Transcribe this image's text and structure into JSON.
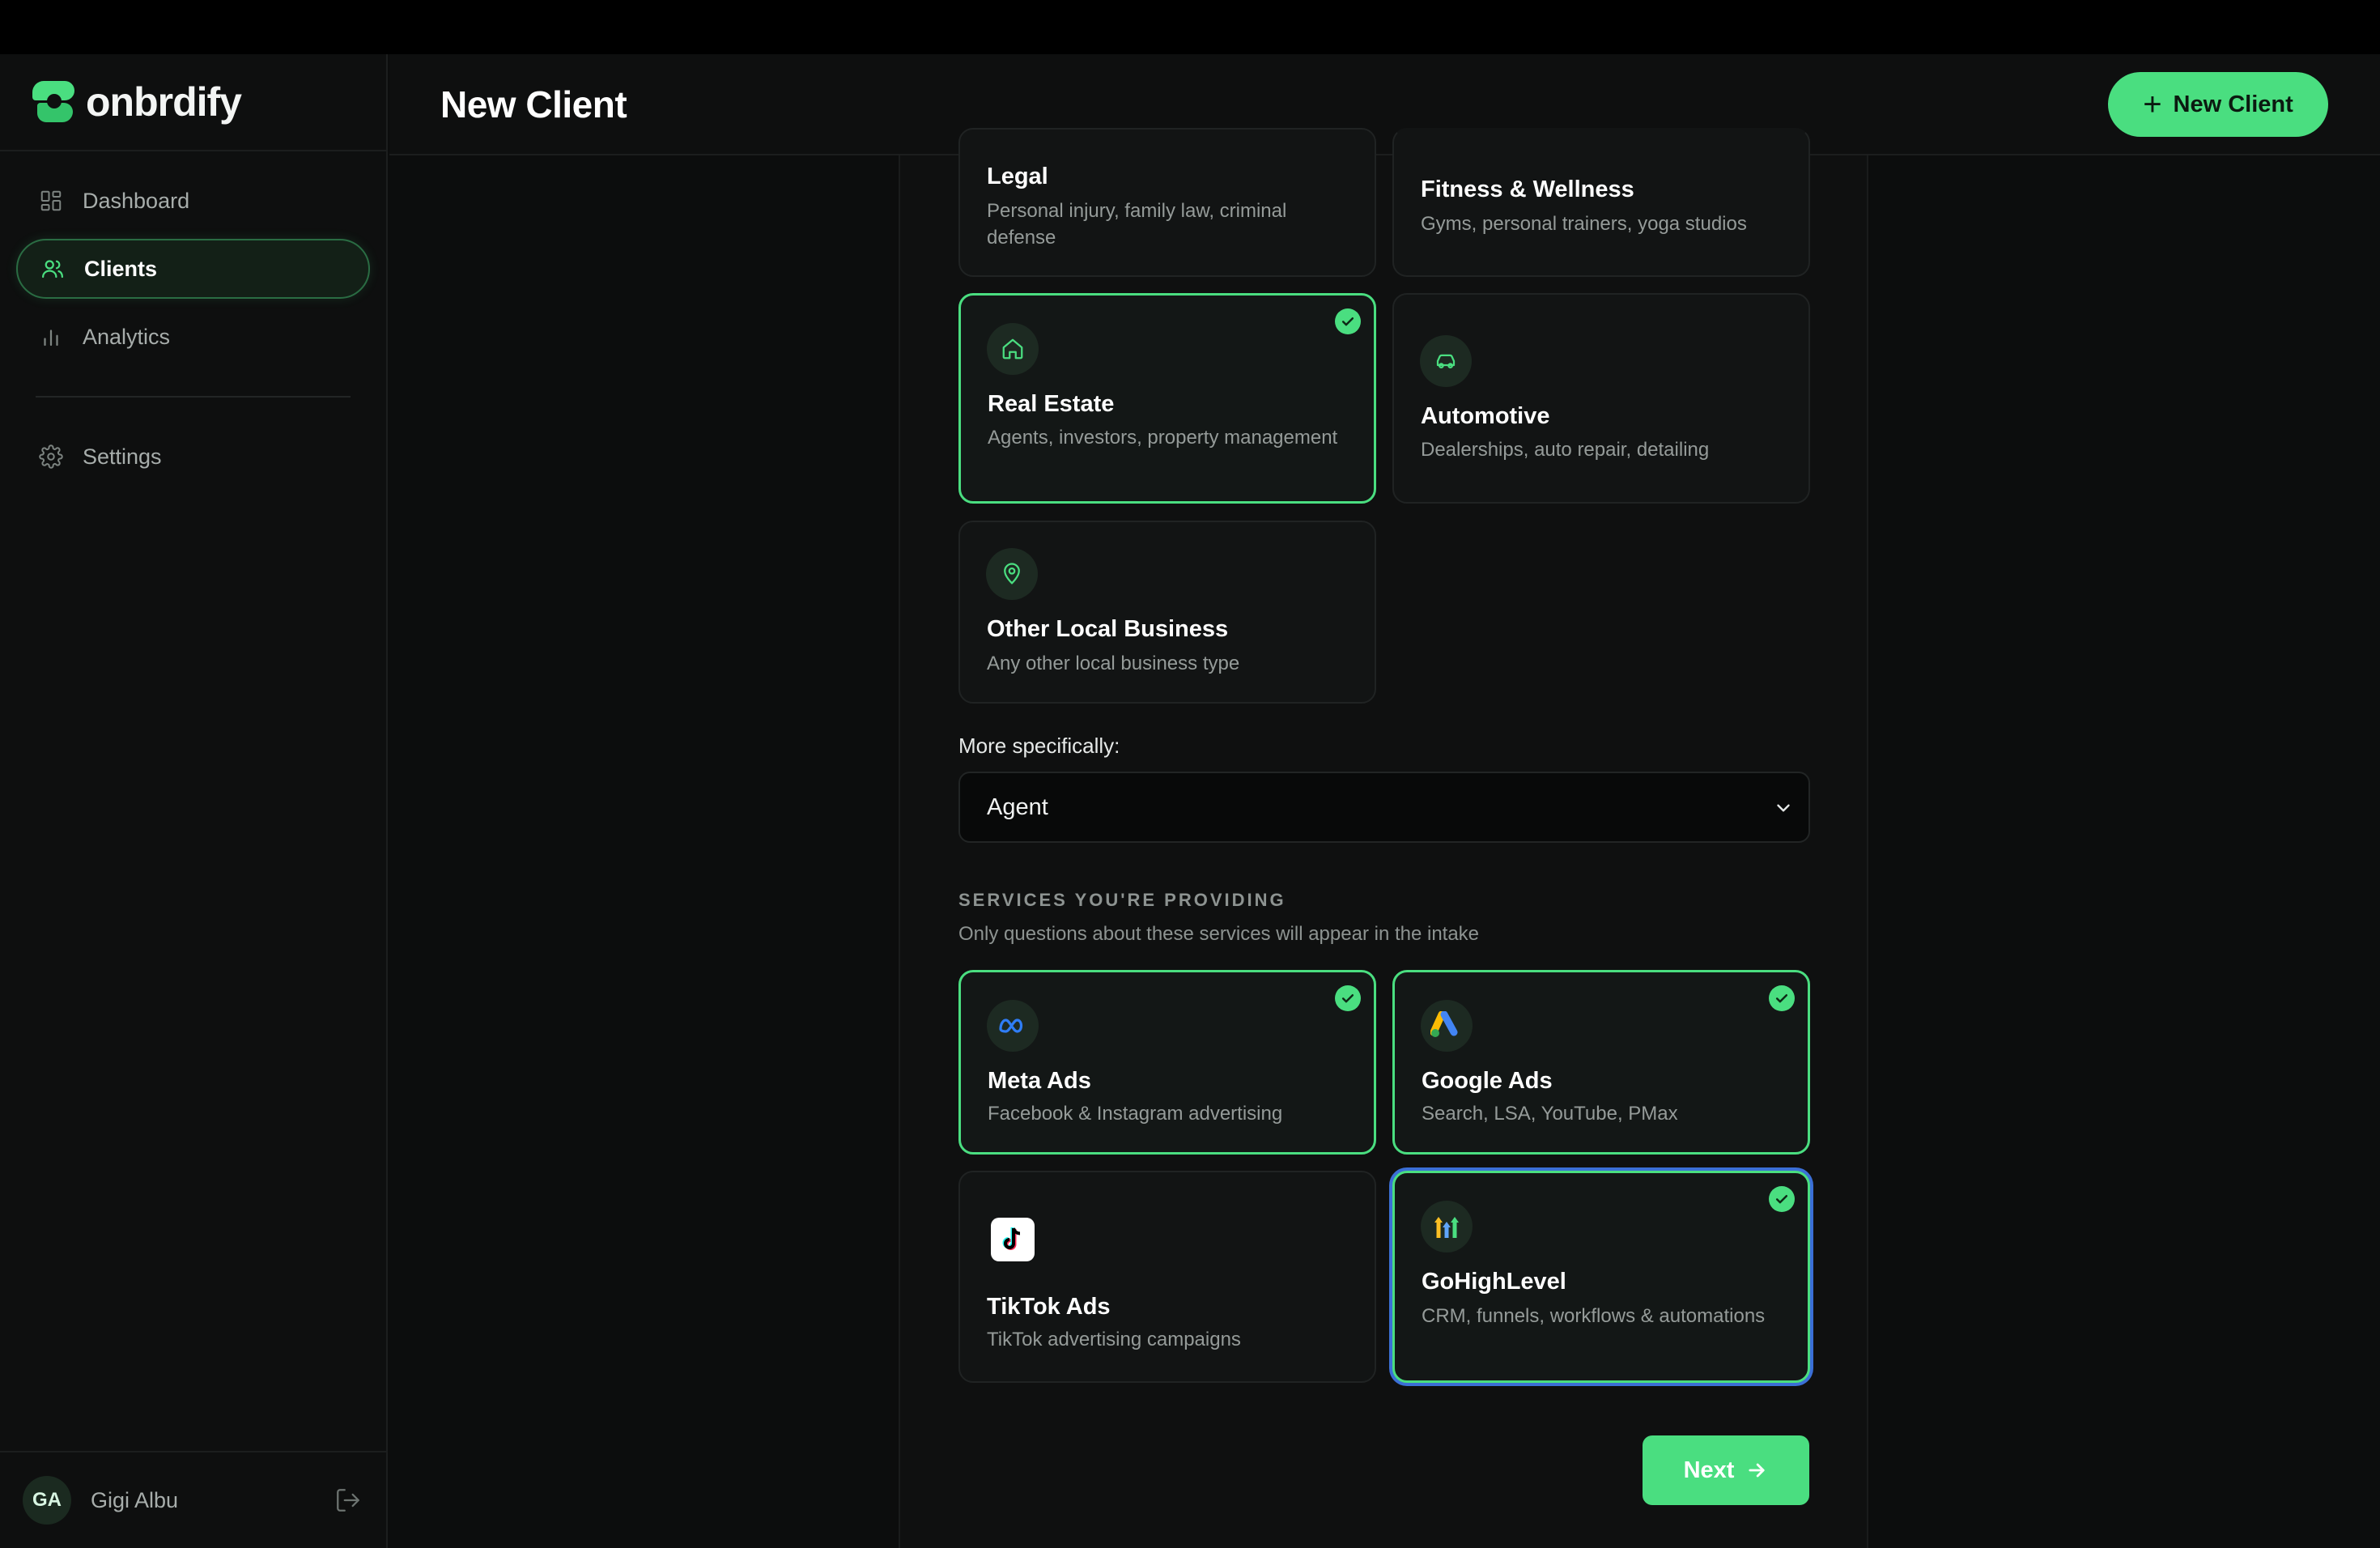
{
  "app": {
    "name": "onbrdify"
  },
  "sidebar": {
    "items": [
      {
        "label": "Dashboard"
      },
      {
        "label": "Clients"
      },
      {
        "label": "Analytics"
      },
      {
        "label": "Settings"
      }
    ],
    "user": {
      "initials": "GA",
      "name": "Gigi Albu"
    }
  },
  "header": {
    "title": "New Client",
    "new_client_label": "New Client"
  },
  "industries": [
    {
      "title": "Legal",
      "desc": "Personal injury, family law, criminal defense"
    },
    {
      "title": "Fitness & Wellness",
      "desc": "Gyms, personal trainers, yoga studios"
    },
    {
      "title": "Real Estate",
      "desc": "Agents, investors, property management"
    },
    {
      "title": "Automotive",
      "desc": "Dealerships, auto repair, detailing"
    },
    {
      "title": "Other Local Business",
      "desc": "Any other local business type"
    }
  ],
  "specifics": {
    "label": "More specifically:",
    "value": "Agent"
  },
  "services": {
    "title": "SERVICES YOU'RE PROVIDING",
    "subtitle": "Only questions about these services will appear in the intake",
    "items": [
      {
        "title": "Meta Ads",
        "desc": "Facebook & Instagram advertising"
      },
      {
        "title": "Google Ads",
        "desc": "Search, LSA, YouTube, PMax"
      },
      {
        "title": "TikTok Ads",
        "desc": "TikTok advertising campaigns"
      },
      {
        "title": "GoHighLevel",
        "desc": "CRM, funnels, workflows & automations"
      }
    ]
  },
  "actions": {
    "next_label": "Next"
  },
  "colors": {
    "accent": "#4ade80",
    "focus_ring": "#3b6fd6",
    "background": "#0c0d0d"
  }
}
